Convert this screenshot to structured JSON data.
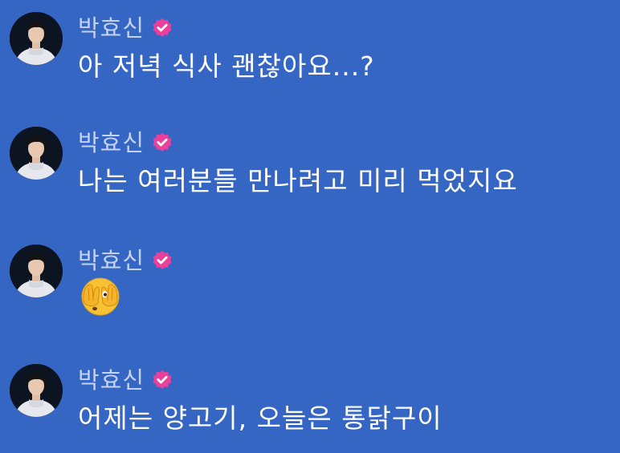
{
  "theme": {
    "background": "#3566c4",
    "name_color": "#c2d2f0",
    "text_color": "#ffffff",
    "badge_color": "#ea3f9a"
  },
  "messages": [
    {
      "sender": "박효신",
      "verified": true,
      "text": "아 저녁 식사 괜찮아요...?"
    },
    {
      "sender": "박효신",
      "verified": true,
      "text": "나는 여러분들 만나려고 미리 먹었지요"
    },
    {
      "sender": "박효신",
      "verified": true,
      "emoji": "face-with-peeking-eye"
    },
    {
      "sender": "박효신",
      "verified": true,
      "text": "어제는 양고기, 오늘은 통닭구이"
    }
  ]
}
